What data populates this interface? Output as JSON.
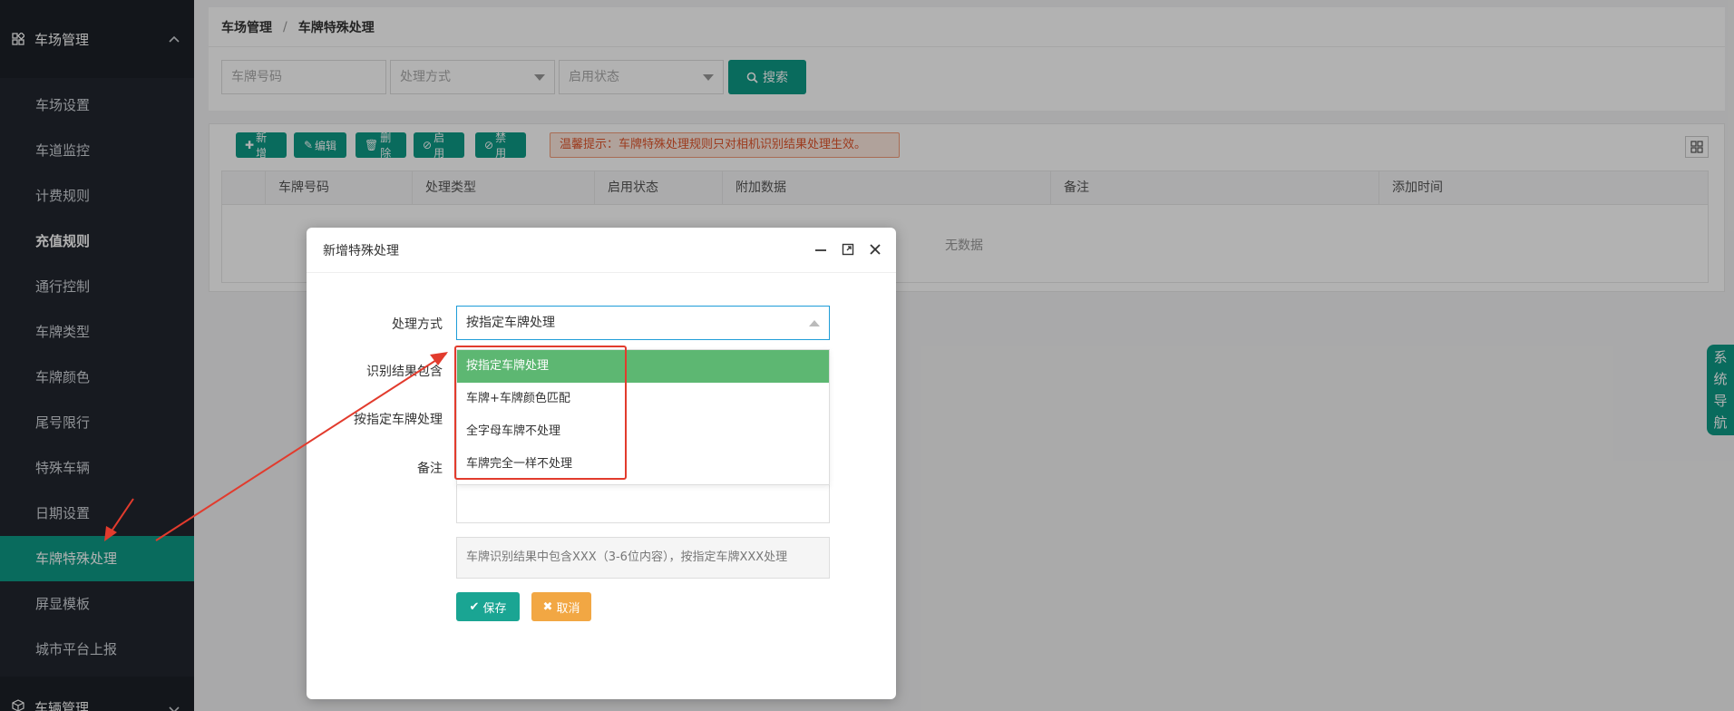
{
  "sidebar": {
    "group1": "车场管理",
    "items": [
      "车场设置",
      "车道监控",
      "计费规则",
      "充值规则",
      "通行控制",
      "车牌类型",
      "车牌颜色",
      "尾号限行",
      "特殊车辆",
      "日期设置",
      "车牌特殊处理",
      "屏显模板",
      "城市平台上报"
    ],
    "group2": "车辆管理"
  },
  "breadcrumb": {
    "parent": "车场管理",
    "sep": "/",
    "current": "车牌特殊处理"
  },
  "filters": {
    "plate_placeholder": "车牌号码",
    "mode_placeholder": "处理方式",
    "status_placeholder": "启用状态",
    "search_label": "搜索"
  },
  "toolbar": {
    "add": "新增",
    "edit": "编辑",
    "delete": "删除",
    "enable": "启用",
    "disable": "禁用",
    "tip": "温馨提示：车牌特殊处理规则只对相机识别结果处理生效。"
  },
  "table": {
    "columns": [
      "车牌号码",
      "处理类型",
      "启用状态",
      "附加数据",
      "备注",
      "添加时间"
    ],
    "empty": "无数据"
  },
  "sysnav": [
    "系",
    "统",
    "导",
    "航"
  ],
  "modal": {
    "title": "新增特殊处理",
    "fields": {
      "mode_label": "处理方式",
      "contains_label": "识别结果包含",
      "plate_label": "按指定车牌处理",
      "remark_label": "备注"
    },
    "mode_value": "按指定车牌处理",
    "options": [
      "按指定车牌处理",
      "车牌+车牌颜色匹配",
      "全字母车牌不处理",
      "车牌完全一样不处理"
    ],
    "hint": "车牌识别结果中包含XXX（3-6位内容），按指定车牌XXX处理",
    "save": "保存",
    "cancel": "取消"
  },
  "colors": {
    "accent": "#0d9a86",
    "sidebar_bg": "#22262e",
    "option_selected": "#5db772",
    "cancel": "#f2a743",
    "annotation": "#e23b2d"
  }
}
